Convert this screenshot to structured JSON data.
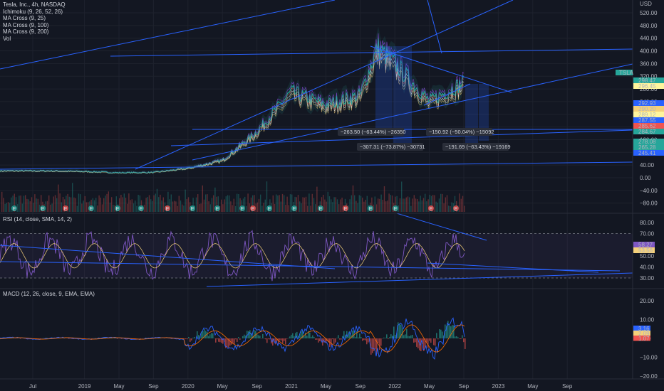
{
  "header": {
    "symbol_line": "Tesla, Inc., 4h, NASDAQ",
    "indicators": [
      "Ichimoku (9, 26, 52, 26)",
      "MA Cross (9, 25)",
      "MA Cross (9, 100)",
      "MA Cross (9, 200)",
      "Vol"
    ],
    "currency": "USD"
  },
  "rsi_legend": "RSI (14, close, SMA, 14, 2)",
  "macd_legend": "MACD (12, 26, close, 9, EMA, EMA)",
  "symbol_tag": "TSLA",
  "colors": {
    "background": "#131722",
    "trendline": "#2962ff",
    "up": "#26a69a",
    "down": "#ef5350",
    "rsi": "#7e57c2",
    "rsi_signal": "#f5d17a",
    "macd": "#2962ff",
    "macd_signal": "#ff6d00"
  },
  "chart_data": [
    {
      "type": "line",
      "pane": "price",
      "title": "Tesla, Inc., 4h, NASDAQ",
      "x": [
        "2018-07",
        "2018-09",
        "2019-01",
        "2019-05",
        "2019-09",
        "2020-01",
        "2020-05",
        "2020-09",
        "2021-01",
        "2021-05",
        "2021-09",
        "2021-11",
        "2022-01",
        "2022-05",
        "2022-09",
        "2023-01"
      ],
      "series": [
        {
          "name": "Tesla, Inc., 4h, NASDAQ",
          "values": [
            22,
            22,
            20,
            16,
            17,
            30,
            55,
            145,
            270,
            230,
            260,
            410,
            360,
            240,
            300,
            null
          ]
        }
      ],
      "yticks": [
        -80,
        -40,
        0,
        40,
        80,
        120,
        160,
        200,
        240,
        280,
        320,
        360,
        400,
        440,
        480,
        520
      ],
      "ylim": [
        -90,
        545
      ],
      "price_labels": [
        "298.47",
        "296.45",
        "292.93",
        "290.20",
        "289.12",
        "287.55",
        "285.62",
        "284.67",
        "278.08",
        "265.28",
        "245.41"
      ],
      "measurements": [
        "−263.50 (−63.44%) −26350",
        "−307.31 (−73.87%) −30731",
        "−150.92 (−50.04%) −15092",
        "−191.69 (−63.43%) −19169"
      ],
      "markers": [
        "E",
        "E",
        "E",
        "E",
        "E",
        "E",
        "E",
        "E",
        "E",
        "E",
        "E",
        "E",
        "E",
        "E",
        "E",
        "E",
        "E",
        "E",
        "E"
      ]
    },
    {
      "type": "line",
      "pane": "rsi",
      "title": "RSI (14, close, SMA, 14, 2)",
      "yticks": [
        30,
        40,
        50,
        60,
        70,
        80
      ],
      "ylim": [
        25,
        88
      ],
      "bands": [
        30,
        70
      ],
      "last_values": [
        "58.27",
        "53.56"
      ]
    },
    {
      "type": "line",
      "pane": "macd",
      "title": "MACD (12, 26, close, 9, EMA, EMA)",
      "yticks": [
        -20,
        -10,
        0,
        10,
        20
      ],
      "ylim": [
        -24,
        25
      ],
      "last_values": [
        "3.16",
        "2.09",
        "1.07"
      ]
    }
  ],
  "time_axis": [
    "Jul",
    "2019",
    "May",
    "Sep",
    "2020",
    "May",
    "Sep",
    "2021",
    "May",
    "Sep",
    "2022",
    "May",
    "Sep",
    "2023",
    "May",
    "Sep"
  ]
}
